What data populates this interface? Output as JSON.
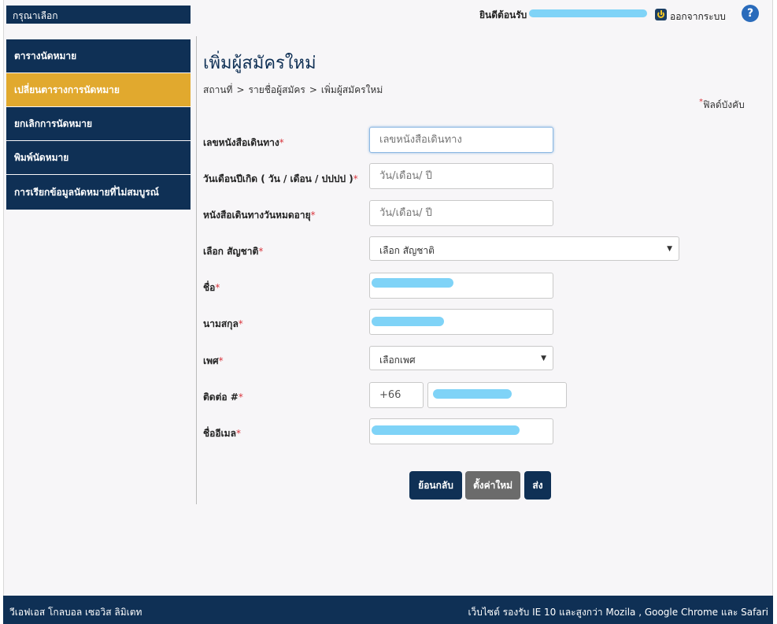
{
  "header": {
    "menu_title": "กรุณาเลือก",
    "welcome": "ยินดีต้อนรับ",
    "logout": "ออกจากระบบ",
    "help": "?"
  },
  "sidebar": {
    "items": [
      {
        "label": "ตารางนัดหมาย",
        "active": false
      },
      {
        "label": "เปลี่ยนตารางการนัดหมาย",
        "active": true
      },
      {
        "label": "ยกเลิกการนัดหมาย",
        "active": false
      },
      {
        "label": "พิมพ์นัดหมาย",
        "active": false
      },
      {
        "label": "การเรียกข้อมูลนัดหมายที่ไม่สมบูรณ์",
        "active": false
      }
    ]
  },
  "main": {
    "title": "เพิ่มผู้สมัครใหม่",
    "breadcrumb": [
      "สถานที่",
      "รายชื่อผู้สมัคร",
      "เพิ่มผู้สมัครใหม่"
    ],
    "breadcrumb_sep": ">",
    "required_note": "ฟิลด์บังคับ",
    "required_star": "*"
  },
  "form": {
    "passport": {
      "label": "เลขหนังสือเดินทาง",
      "placeholder": "เลขหนังสือเดินทาง"
    },
    "dob": {
      "label": "วันเดือนปีเกิด ( วัน / เดือน / ปปปป )",
      "placeholder": "วัน/เดือน/ ปี"
    },
    "passport_expiry": {
      "label": "หนังสือเดินทางวันหมดอายุ",
      "placeholder": "วัน/เดือน/ ปี"
    },
    "nationality": {
      "label": "เลือก สัญชาติ",
      "value": "เลือก สัญชาติ"
    },
    "first_name": {
      "label": "ชื่อ"
    },
    "last_name": {
      "label": "นามสกุล"
    },
    "gender": {
      "label": "เพศ",
      "value": "เลือกเพศ"
    },
    "contact": {
      "label": "ติดต่อ #",
      "country_code": "+66"
    },
    "email": {
      "label": "ชื่ออีเมล"
    }
  },
  "buttons": {
    "back": "ย้อนกลับ",
    "reset": "ตั้งค่าใหม่",
    "submit": "ส่ง"
  },
  "footer": {
    "company": "วีเอฟเอส โกลบอล เซอวิส ลิมิเตท",
    "browser_note": "เว็บไซต์ รองรับ IE 10 และสูงกว่า Mozila , Google Chrome และ Safari"
  },
  "colors": {
    "navy": "#0f3055",
    "active": "#e1a92e",
    "required": "#d9363e",
    "redaction": "#7fd3f7"
  }
}
